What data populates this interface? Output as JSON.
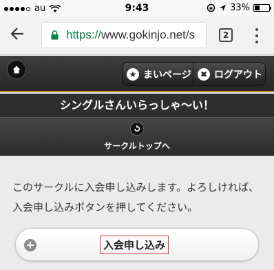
{
  "status_bar": {
    "carrier": "au",
    "time": "9:43",
    "battery": "33%",
    "battery_level": 0.33,
    "signal_bars_filled": 4
  },
  "browser": {
    "url_scheme": "https://",
    "url_rest": "www.gokinjo.net/s",
    "tab_count": "2",
    "icons": [
      "back-arrow-icon",
      "lock-icon",
      "tab-switcher-icon",
      "overflow-menu-icon"
    ]
  },
  "header": {
    "mypage_label": "まいページ",
    "logout_label": "ログアウト",
    "accent_color": "#c0832e"
  },
  "page": {
    "title": "シングルさんいらっしゃ〜い！",
    "circle_top_label": "サークルトップへ",
    "message": "このサークルに入会申し込みします。よろしければ、入会申し込みボタンを押してください。",
    "join_button_label": "入会申し込み"
  }
}
